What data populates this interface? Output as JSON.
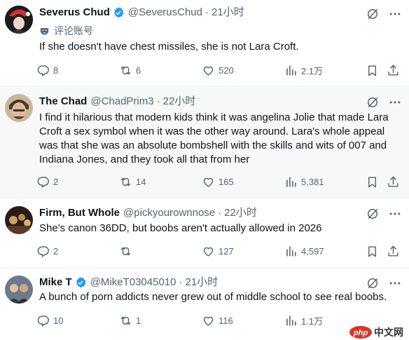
{
  "tweets": [
    {
      "name": "Severus Chud",
      "handle": "@SeverusChud",
      "dot": "·",
      "time": "21小时",
      "label": "评论账号",
      "text": "If she doesn't have chest missiles, she is not Lara Croft.",
      "replies": "8",
      "reposts": "6",
      "likes": "520",
      "views": "2.1万"
    },
    {
      "name": "The Chad",
      "handle": "@ChadPrim3",
      "dot": "·",
      "time": "22小时",
      "text": "I find it hilarious that modern kids think it was angelina Jolie that made Lara Croft a sex symbol when it was the other way around.  Lara's whole appeal was that she was an absolute bombshell with the skills and wits of 007 and Indiana Jones, and they took all that from her",
      "replies": "2",
      "reposts": "14",
      "likes": "165",
      "views": "5,381"
    },
    {
      "name": "Firm, But Whole",
      "handle": "@pickyourownnose",
      "dot": "·",
      "time": "22小时",
      "text": "She's canon 36DD, but boobs aren't actually allowed in 2026",
      "replies": "2",
      "reposts": "",
      "likes": "127",
      "views": "4,597"
    },
    {
      "name": "Mike T",
      "handle": "@MikeT03045010",
      "dot": "·",
      "time": "21小时",
      "text": "A bunch of porn addicts never grew out of middle school to see real boobs.",
      "replies": "10",
      "reposts": "1",
      "likes": "116",
      "views": "1.1万"
    }
  ],
  "watermark": {
    "logo": "php",
    "text": "中文网"
  },
  "colors": {
    "verified": "#1d9bf0",
    "muted": "#536471",
    "text": "#0f1419",
    "highlight_bg": "#f7f9f9"
  }
}
